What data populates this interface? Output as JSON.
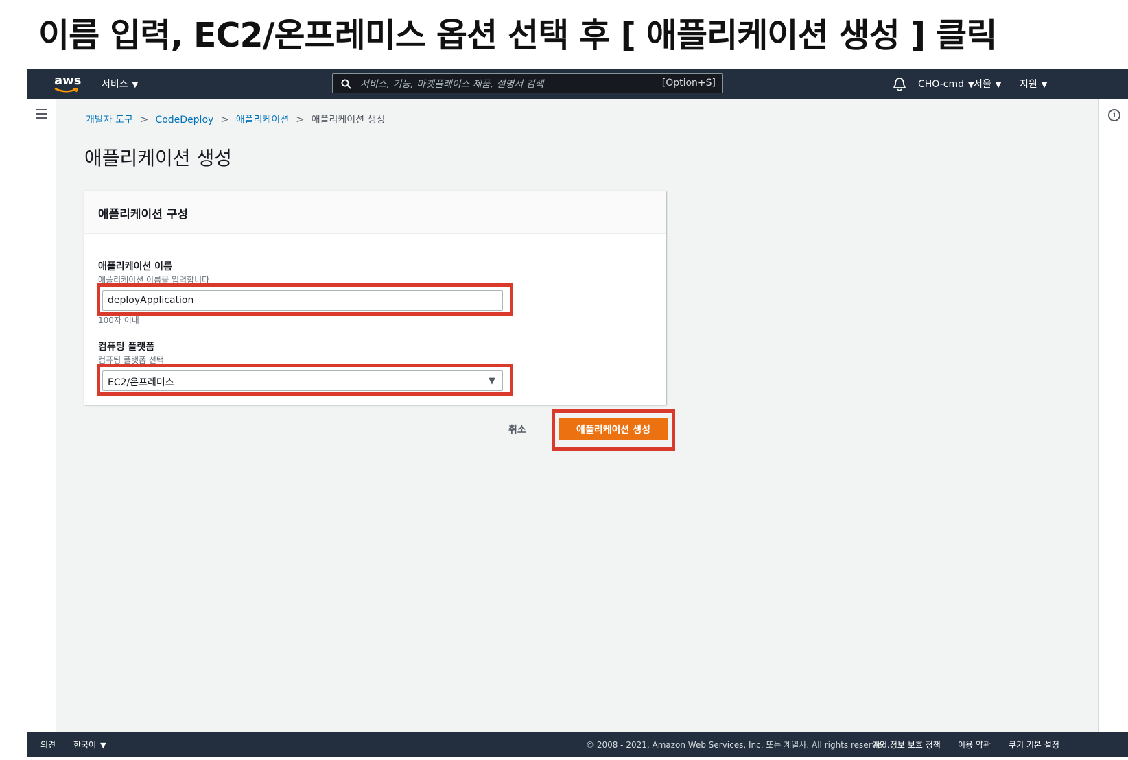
{
  "slide": {
    "title": "이름 입력, EC2/온프레미스 옵션 선택 후 [ 애플리케이션 생성 ] 클릭"
  },
  "nav": {
    "logo": "aws",
    "services": "서비스",
    "search_placeholder": "서비스, 기능, 마켓플레이스 제품, 설명서 검색",
    "search_shortcut": "[Option+S]",
    "account": "CHO-cmd",
    "region": "서울",
    "support": "지원"
  },
  "breadcrumb": {
    "items": [
      "개발자 도구",
      "CodeDeploy",
      "애플리케이션"
    ],
    "current": "애플리케이션 생성"
  },
  "page": {
    "title": "애플리케이션 생성"
  },
  "form": {
    "panel_title": "애플리케이션 구성",
    "name_label": "애플리케이션 이름",
    "name_description": "애플리케이션 이름을 입력합니다",
    "name_value": "deployApplication",
    "name_constraint": "100자 이내",
    "platform_label": "컴퓨팅 플랫폼",
    "platform_description": "컴퓨팅 플랫폼 선택",
    "platform_value": "EC2/온프레미스"
  },
  "actions": {
    "cancel": "취소",
    "create": "애플리케이션 생성"
  },
  "footer": {
    "feedback": "의견",
    "language": "한국어",
    "copyright": "© 2008 - 2021, Amazon Web Services, Inc. 또는 계열사. All rights reserved.",
    "privacy": "개인 정보 보호 정책",
    "terms": "이용 약관",
    "cookies": "쿠키 기본 설정"
  },
  "colors": {
    "nav_bg": "#232f3e",
    "accent": "#ec7211",
    "link": "#0073bb",
    "highlight": "#d93a2b"
  }
}
